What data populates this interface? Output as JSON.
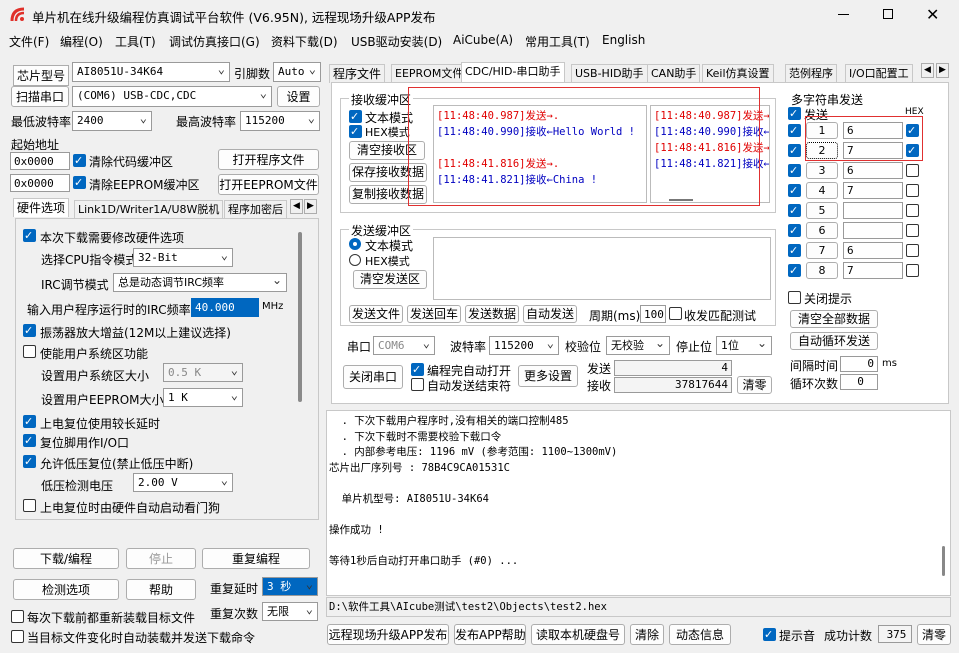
{
  "title": "单片机在线升级编程仿真调试平台软件 (V6.95N), 远程现场升级APP发布",
  "menu": [
    "文件(F)",
    "编程(O)",
    "工具(T)",
    "调试仿真接口(G)",
    "资料下载(D)",
    "USB驱动安装(D)",
    "AiCube(A)",
    "常用工具(T)",
    "English"
  ],
  "left": {
    "chip_label": "芯片型号",
    "chip_value": "AI8051U-34K64",
    "pin_label": "引脚数",
    "pin_value": "Auto",
    "scan_btn": "扫描串口",
    "port_value": "(COM6) USB-CDC,CDC",
    "settings_btn": "设置",
    "min_baud_label": "最低波特率",
    "min_baud": "2400",
    "max_baud_label": "最高波特率",
    "max_baud": "115200",
    "start_addr": "起始地址",
    "addr1": "0x0000",
    "clear_code": "清除代码缓冲区",
    "open_prog": "打开程序文件",
    "addr2": "0x0000",
    "clear_eeprom": "清除EEPROM缓冲区",
    "open_eeprom": "打开EEPROM文件",
    "tabs": [
      "硬件选项",
      "Link1D/Writer1A/U8W脱机",
      "程序加密后"
    ],
    "opts": {
      "modify_hw": "本次下载需要修改硬件选项",
      "cpu_label": "选择CPU指令模式",
      "cpu_value": "32-Bit",
      "irc_label": "IRC调节模式",
      "irc_value": "总是动态调节IRC频率",
      "freq_label": "输入用户程序运行时的IRC频率",
      "freq_value": "40.000",
      "freq_unit": "MHz",
      "osc": "振荡器放大增益(12M以上建议选择)",
      "user_sys": "使能用户系统区功能",
      "user_sys_size_label": "设置用户系统区大小",
      "user_sys_size": "0.5 K",
      "eeprom_size_label": "设置用户EEPROM大小",
      "eeprom_size": "1   K",
      "por_delay": "上电复位使用较长延时",
      "reset_io": "复位脚用作I/O口",
      "lvr": "允许低压复位(禁止低压中断)",
      "lvd_label": "低压检测电压",
      "lvd_value": "2.00 V",
      "wdt": "上电复位时由硬件自动启动看门狗"
    },
    "btn_download": "下载/编程",
    "btn_stop": "停止",
    "btn_reprog": "重复编程",
    "btn_detect": "检测选项",
    "btn_help": "帮助",
    "repeat_delay_label": "重复延时",
    "repeat_delay": "3 秒",
    "repeat_count_label": "重复次数",
    "repeat_count": "无限",
    "reload_each": "每次下载前都重新装载目标文件",
    "auto_send": "当目标文件变化时自动装载并发送下载命令"
  },
  "tabs": [
    "程序文件",
    "EEPROM文件",
    "CDC/HID-串口助手",
    "USB-HID助手",
    "CAN助手",
    "Keil仿真设置",
    "范例程序",
    "I/O口配置工"
  ],
  "recv": {
    "title": "接收缓冲区",
    "text_mode": "文本模式",
    "hex_mode": "HEX模式",
    "clear": "清空接收区",
    "save": "保存接收数据",
    "copy": "复制接收数据",
    "lines_left": [
      {
        "t": "[11:48:40.987]发送→.",
        "c": "red"
      },
      {
        "t": "[11:48:40.990]接收←Hello World !",
        "c": "blu"
      },
      {
        "t": "",
        "c": "blu"
      },
      {
        "t": "[11:48:41.816]发送→.",
        "c": "red"
      },
      {
        "t": "[11:48:41.821]接收←China !",
        "c": "blu"
      }
    ],
    "lines_right": [
      {
        "t": "[11:48:40.987]发送→",
        "c": "red"
      },
      {
        "t": "[11:48:40.990]接收←",
        "c": "blu"
      },
      {
        "t": "[11:48:41.816]发送→",
        "c": "red"
      },
      {
        "t": "[11:48:41.821]接收←",
        "c": "blu"
      }
    ]
  },
  "send": {
    "title": "发送缓冲区",
    "text_mode": "文本模式",
    "hex_mode": "HEX模式",
    "clear": "清空发送区",
    "btns": [
      "发送文件",
      "发送回车",
      "发送数据",
      "自动发送"
    ],
    "period_label": "周期(ms)",
    "period": "100",
    "match": "收发匹配测试"
  },
  "serial": {
    "port_label": "串口",
    "port": "COM6",
    "baud_label": "波特率",
    "baud": "115200",
    "parity_label": "校验位",
    "parity": "无校验",
    "stop_label": "停止位",
    "stop": "1位",
    "close_btn": "关闭串口",
    "auto_open": "编程完自动打开",
    "auto_end": "自动发送结束符",
    "more": "更多设置",
    "send_label": "发送",
    "send_count": "4",
    "recv_label": "接收",
    "recv_count": "37817644",
    "clear": "清零"
  },
  "multi": {
    "title": "多字符串发送",
    "send_col": "发送",
    "hex_col": "HEX",
    "rows": [
      {
        "n": "1",
        "v": "6",
        "hex": true
      },
      {
        "n": "2",
        "v": "7",
        "hex": true
      },
      {
        "n": "3",
        "v": "6",
        "hex": false
      },
      {
        "n": "4",
        "v": "7",
        "hex": false
      },
      {
        "n": "5",
        "v": "",
        "hex": false
      },
      {
        "n": "6",
        "v": "",
        "hex": false
      },
      {
        "n": "7",
        "v": "6",
        "hex": false
      },
      {
        "n": "8",
        "v": "7",
        "hex": false
      }
    ],
    "close_hint": "关闭提示",
    "clear_all": "清空全部数据",
    "auto_loop": "自动循环发送",
    "interval_label": "间隔时间",
    "interval": "0",
    "interval_unit": "ms",
    "loop_label": "循环次数",
    "loop": "0"
  },
  "log": [
    "  . 下次下载用户程序时,没有相关的端口控制485",
    "  . 下次下载时不需要校验下载口令",
    "  . 内部参考电压: 1196 mV (参考范围: 1100~1300mV)",
    "芯片出厂序列号 : 78B4C9CA01531C",
    "",
    "  单片机型号: AI8051U-34K64",
    "",
    "操作成功 !",
    "",
    "等待1秒后自动打开串口助手 (#0) ..."
  ],
  "path": "D:\\软件工具\\AIcube测试\\test2\\Objects\\test2.hex",
  "bottom": {
    "btns": [
      "远程现场升级APP发布",
      "发布APP帮助",
      "读取本机硬盘号",
      "清除",
      "动态信息"
    ],
    "hint": "提示音",
    "success_label": "成功计数",
    "success": "375",
    "clear": "清零"
  }
}
